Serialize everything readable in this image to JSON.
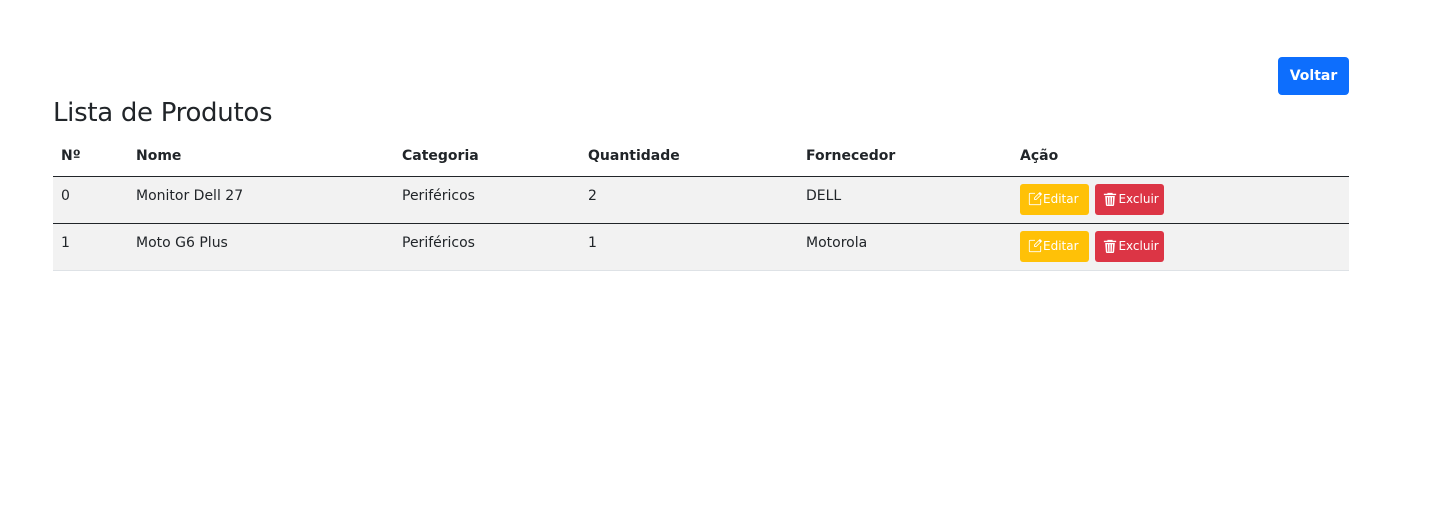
{
  "header": {
    "back_label": "Voltar",
    "title": "Lista de Produtos"
  },
  "table": {
    "columns": [
      "Nº",
      "Nome",
      "Categoria",
      "Quantidade",
      "Fornecedor",
      "Ação"
    ],
    "rows": [
      {
        "n": "0",
        "nome": "Monitor Dell 27",
        "categoria": "Periféricos",
        "quantidade": "2",
        "fornecedor": "DELL",
        "edit_label": "Editar",
        "delete_label": "Excluir"
      },
      {
        "n": "1",
        "nome": "Moto G6 Plus",
        "categoria": "Periféricos",
        "quantidade": "1",
        "fornecedor": "Motorola",
        "edit_label": "Editar",
        "delete_label": "Excluir"
      }
    ]
  },
  "colors": {
    "primary": "#0d6efd",
    "warning": "#ffc107",
    "danger": "#dc3545",
    "row_bg": "#f2f2f2"
  },
  "icons": {
    "edit": "pencil-square-icon",
    "delete": "trash-icon"
  }
}
